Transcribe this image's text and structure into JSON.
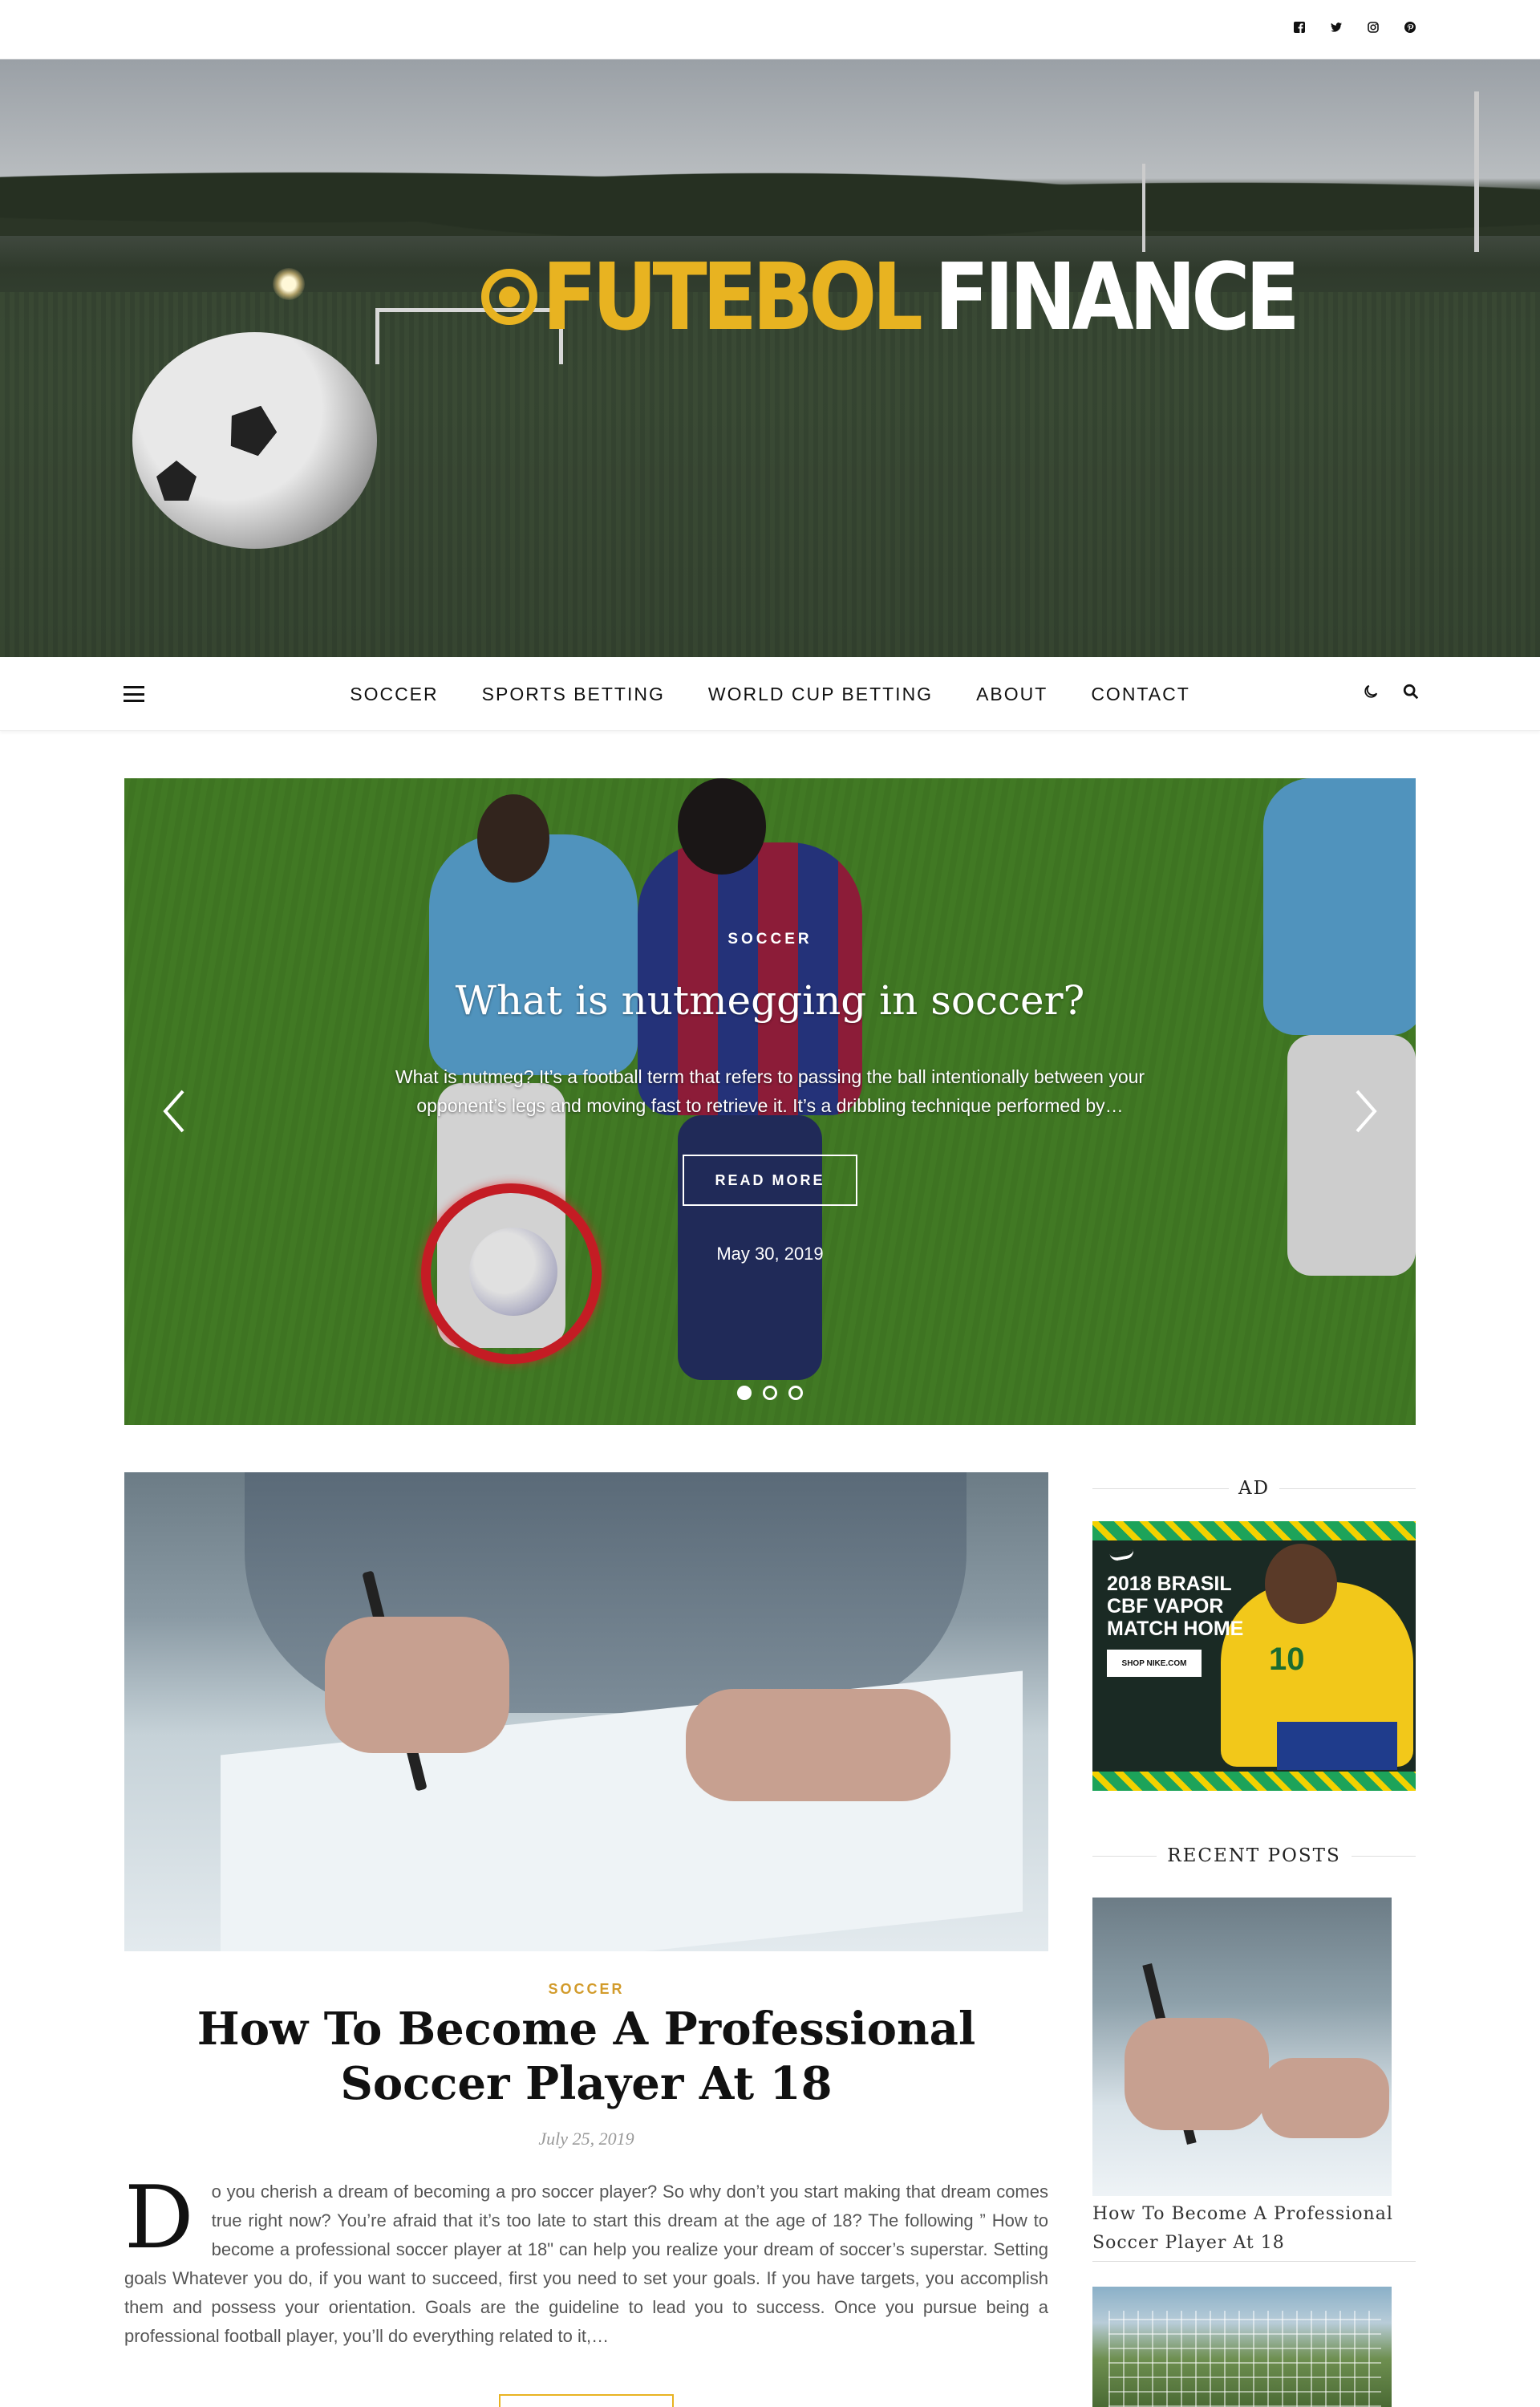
{
  "social": {
    "facebook": "f",
    "twitter": "t",
    "instagram": "i",
    "pinterest": "p"
  },
  "brand": {
    "word1": "FUTEBOL",
    "word2": "FINANCE",
    "accent_color": "#e8b321"
  },
  "nav": {
    "items": [
      {
        "label": "SOCCER"
      },
      {
        "label": "SPORTS BETTING"
      },
      {
        "label": "WORLD CUP BETTING"
      },
      {
        "label": "ABOUT"
      },
      {
        "label": "CONTACT"
      }
    ]
  },
  "slider": {
    "category": "SOCCER",
    "title": "What is nutmegging in soccer?",
    "excerpt": "What is nutmeg? It’s a football term that refers to passing the ball intentionally between your opponent’s legs and moving fast to retrieve it. It’s a dribbling technique performed by…",
    "button": "READ MORE",
    "date": "May 30, 2019",
    "active_slide": 1,
    "total_slides": 3
  },
  "post": {
    "category": "SOCCER",
    "title": "How To Become A Professional Soccer Player At 18",
    "date": "July 25, 2019",
    "dropcap": "D",
    "body": "o you cherish a dream of becoming a pro soccer player? So why don’t you start making that dream comes true right now? You’re afraid that it’s too late to start this dream at the age of 18? The following ” How to become a professional soccer player at 18\" can help you realize your dream of soccer’s superstar. Setting goals Whatever you do, if you want to succeed, first you need to set your goals. If you have targets, you accomplish them and possess your orientation. Goals are the guideline to lead you to success. Once you pursue being a professional football player, you’ll do everything related to it,…"
  },
  "sidebar": {
    "ad_title": "AD",
    "ad": {
      "line1": "2018 BRASIL",
      "line2": "CBF VAPOR",
      "line3": "MATCH HOME",
      "button": "SHOP NIKE.COM",
      "jersey_number": "10"
    },
    "recent_title": "RECENT POSTS",
    "recent_posts": [
      {
        "title": "How To Become A Professional Soccer Player At 18"
      }
    ]
  }
}
